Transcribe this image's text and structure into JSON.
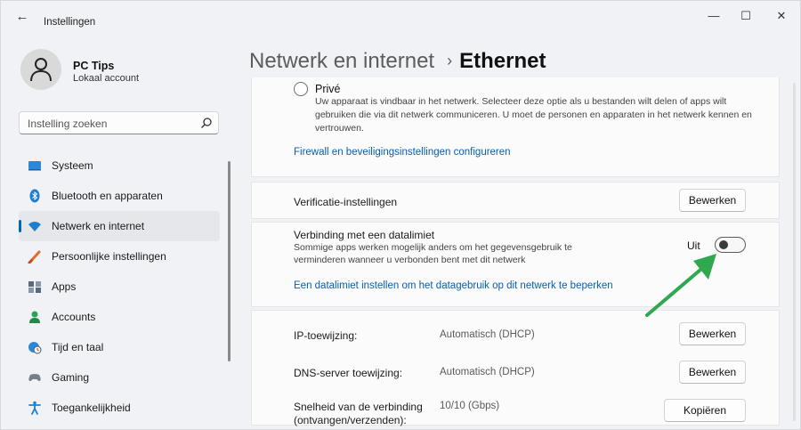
{
  "window": {
    "title": "Instellingen",
    "back_icon": "back-arrow-icon",
    "controls": {
      "minimize": "—",
      "maximize": "☐",
      "close": "✕"
    }
  },
  "profile": {
    "name": "PC Tips",
    "account": "Lokaal account"
  },
  "search": {
    "placeholder": "Instelling zoeken"
  },
  "sidebar": {
    "items": [
      {
        "label": "Systeem",
        "icon": "system-icon"
      },
      {
        "label": "Bluetooth en apparaten",
        "icon": "bluetooth-icon"
      },
      {
        "label": "Netwerk en internet",
        "icon": "network-icon",
        "active": true
      },
      {
        "label": "Persoonlijke instellingen",
        "icon": "brush-icon"
      },
      {
        "label": "Apps",
        "icon": "apps-icon"
      },
      {
        "label": "Accounts",
        "icon": "accounts-icon"
      },
      {
        "label": "Tijd en taal",
        "icon": "globe-clock-icon"
      },
      {
        "label": "Gaming",
        "icon": "gamepad-icon"
      },
      {
        "label": "Toegankelijkheid",
        "icon": "accessibility-icon"
      }
    ]
  },
  "header": {
    "parent": "Netwerk en internet",
    "separator": "›",
    "current": "Ethernet"
  },
  "network_profile": {
    "option_label": "Privé",
    "option_description": "Uw apparaat is vindbaar in het netwerk. Selecteer deze optie als u bestanden wilt delen of apps wilt gebruiken die via dit netwerk communiceren. U moet de personen en apparaten in het netwerk kennen en vertrouwen.",
    "firewall_link": "Firewall en beveiligingsinstellingen configureren"
  },
  "verification": {
    "label": "Verificatie-instellingen",
    "button": "Bewerken"
  },
  "metered": {
    "label": "Verbinding met een datalimiet",
    "description": "Sommige apps werken mogelijk anders om het gegevensgebruik te verminderen wanneer u verbonden bent met dit netwerk",
    "toggle_state": "Uit",
    "toggle_on": false,
    "link": "Een datalimiet instellen om het datagebruik op dit netwerk te beperken"
  },
  "properties": [
    {
      "label": "IP-toewijzing:",
      "value": "Automatisch (DHCP)",
      "button": "Bewerken"
    },
    {
      "label": "DNS-server toewijzing:",
      "value": "Automatisch (DHCP)",
      "button": "Bewerken"
    },
    {
      "label": "Snelheid van de verbinding (ontvangen/verzenden):",
      "value": "10/10 (Gbps)",
      "button": "Kopiëren"
    }
  ],
  "colors": {
    "accent": "#0067c0",
    "link": "#0a5ea8",
    "annotation_arrow": "#2fa84f"
  }
}
